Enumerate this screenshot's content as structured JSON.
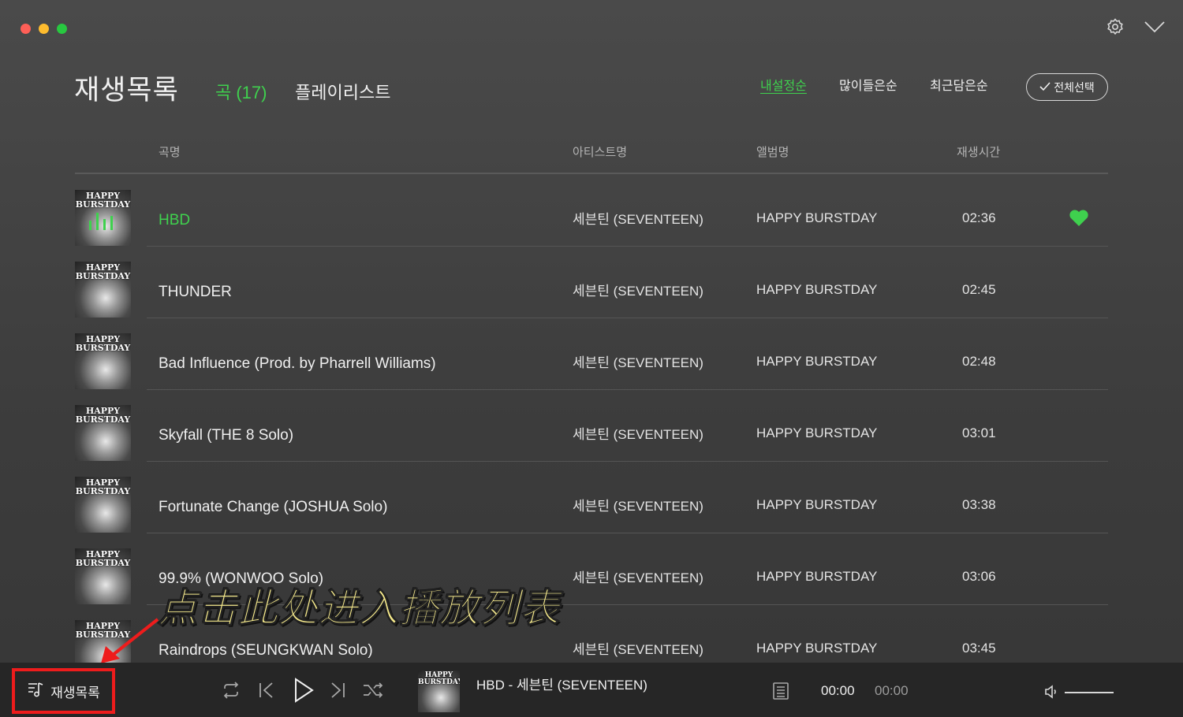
{
  "header": {
    "title": "재생목록",
    "tab_songs": "곡 (17)",
    "tab_playlists": "플레이리스트",
    "sort_options": [
      "내설정순",
      "많이들은순",
      "최근담은순"
    ],
    "select_all": "전체선택"
  },
  "columns": {
    "song": "곡명",
    "artist": "아티스트명",
    "album": "앨범명",
    "duration": "재생시간"
  },
  "album_art_text": "HAPPY BURSTDAY",
  "songs": [
    {
      "title": "HBD",
      "artist": "세븐틴 (SEVENTEEN)",
      "album": "HAPPY BURSTDAY",
      "duration": "02:36",
      "playing": true,
      "liked": true
    },
    {
      "title": "THUNDER",
      "artist": "세븐틴 (SEVENTEEN)",
      "album": "HAPPY BURSTDAY",
      "duration": "02:45"
    },
    {
      "title": "Bad Influence (Prod. by Pharrell Williams)",
      "artist": "세븐틴 (SEVENTEEN)",
      "album": "HAPPY BURSTDAY",
      "duration": "02:48"
    },
    {
      "title": "Skyfall (THE 8 Solo)",
      "artist": "세븐틴 (SEVENTEEN)",
      "album": "HAPPY BURSTDAY",
      "duration": "03:01"
    },
    {
      "title": "Fortunate Change (JOSHUA Solo)",
      "artist": "세븐틴 (SEVENTEEN)",
      "album": "HAPPY BURSTDAY",
      "duration": "03:38"
    },
    {
      "title": "99.9% (WONWOO Solo)",
      "artist": "세븐틴 (SEVENTEEN)",
      "album": "HAPPY BURSTDAY",
      "duration": "03:06"
    },
    {
      "title": "Raindrops (SEUNGKWAN Solo)",
      "artist": "세븐틴 (SEVENTEEN)",
      "album": "HAPPY BURSTDAY",
      "duration": "03:45"
    }
  ],
  "annotation": "点击此处进入播放列表",
  "player": {
    "playlist_label": "재생목록",
    "now_playing": "HBD - 세븐틴 (SEVENTEEN)",
    "current_time": "00:00",
    "total_time": "00:00"
  },
  "colors": {
    "accent": "#3fd14e",
    "highlight_border": "#ee1c1c",
    "annotation": "#f6ea8c"
  }
}
